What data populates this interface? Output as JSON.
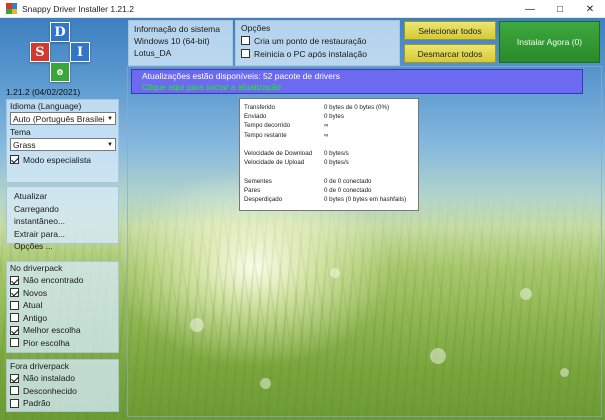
{
  "window": {
    "title": "Snappy Driver Installer 1.21.2",
    "minimize_icon": "minimize-icon",
    "maximize_icon": "maximize-icon",
    "close_icon": "close-icon"
  },
  "logo": {
    "letters": [
      "S",
      "D",
      "I"
    ]
  },
  "version": "1.21.2 (04/02/2021)",
  "system_info": {
    "title": "Informação do sistema",
    "os": "Windows 10 (64-bit)",
    "machine": "Lotus_DA"
  },
  "options": {
    "title": "Opções",
    "items": [
      {
        "label": "Cria um ponto de restauração",
        "checked": false
      },
      {
        "label": "Reinicia o PC após instalação",
        "checked": false
      }
    ]
  },
  "buttons": {
    "select_all": "Selecionar todos",
    "deselect_all": "Desmarcar todos",
    "install_now": "Instalar Agora (0)"
  },
  "language": {
    "label": "Idioma (Language)",
    "value": "Auto (Português Brasileiro)"
  },
  "theme": {
    "label": "Tema",
    "value": "Grass"
  },
  "expert_mode": {
    "label": "Modo especialista",
    "checked": true
  },
  "actions": [
    "Atualizar",
    "Carregando instantâneo...",
    "Extrair para...",
    "Opções ..."
  ],
  "driverpack": {
    "title": "No driverpack",
    "items": [
      {
        "label": "Não encontrado",
        "checked": true
      },
      {
        "label": "Novos",
        "checked": true
      },
      {
        "label": "Atual",
        "checked": false
      },
      {
        "label": "Antigo",
        "checked": false
      },
      {
        "label": "Melhor escolha",
        "checked": true
      },
      {
        "label": "Pior escolha",
        "checked": false
      }
    ]
  },
  "fora_driverpack": {
    "title": "Fora driverpack",
    "items": [
      {
        "label": "Não instalado",
        "checked": true
      },
      {
        "label": "Desconhecido",
        "checked": false
      },
      {
        "label": "Padrão",
        "checked": false
      }
    ]
  },
  "banner": {
    "line1": "Atualizações estão disponíveis: 52 pacote de drivers",
    "line2": "Clique aqui para iniciar a atualização"
  },
  "stats": [
    {
      "k": "Transferido",
      "v": "0 bytes de 0 bytes (0%)"
    },
    {
      "k": "Enviado",
      "v": "0 bytes"
    },
    {
      "k": "Tempo decorrido",
      "v": "∞"
    },
    {
      "k": "Tempo restante",
      "v": "∞"
    },
    {
      "k": "",
      "v": ""
    },
    {
      "k": "Velocidade de Download",
      "v": "0 bytes/s"
    },
    {
      "k": "Velocidade de Upload",
      "v": "0 bytes/s"
    },
    {
      "k": "",
      "v": ""
    },
    {
      "k": "Sementes",
      "v": "0 de 0 conectado"
    },
    {
      "k": "Pares",
      "v": "0 de 0 conectado"
    },
    {
      "k": "Desperdiçado",
      "v": "0 bytes (0 bytes em hashfails)"
    }
  ],
  "colors": {
    "banner_bg": "#6d6af2",
    "banner_line2": "#1ef01e",
    "install_button": "#2e8f2e",
    "select_buttons": "#e0d64c"
  }
}
